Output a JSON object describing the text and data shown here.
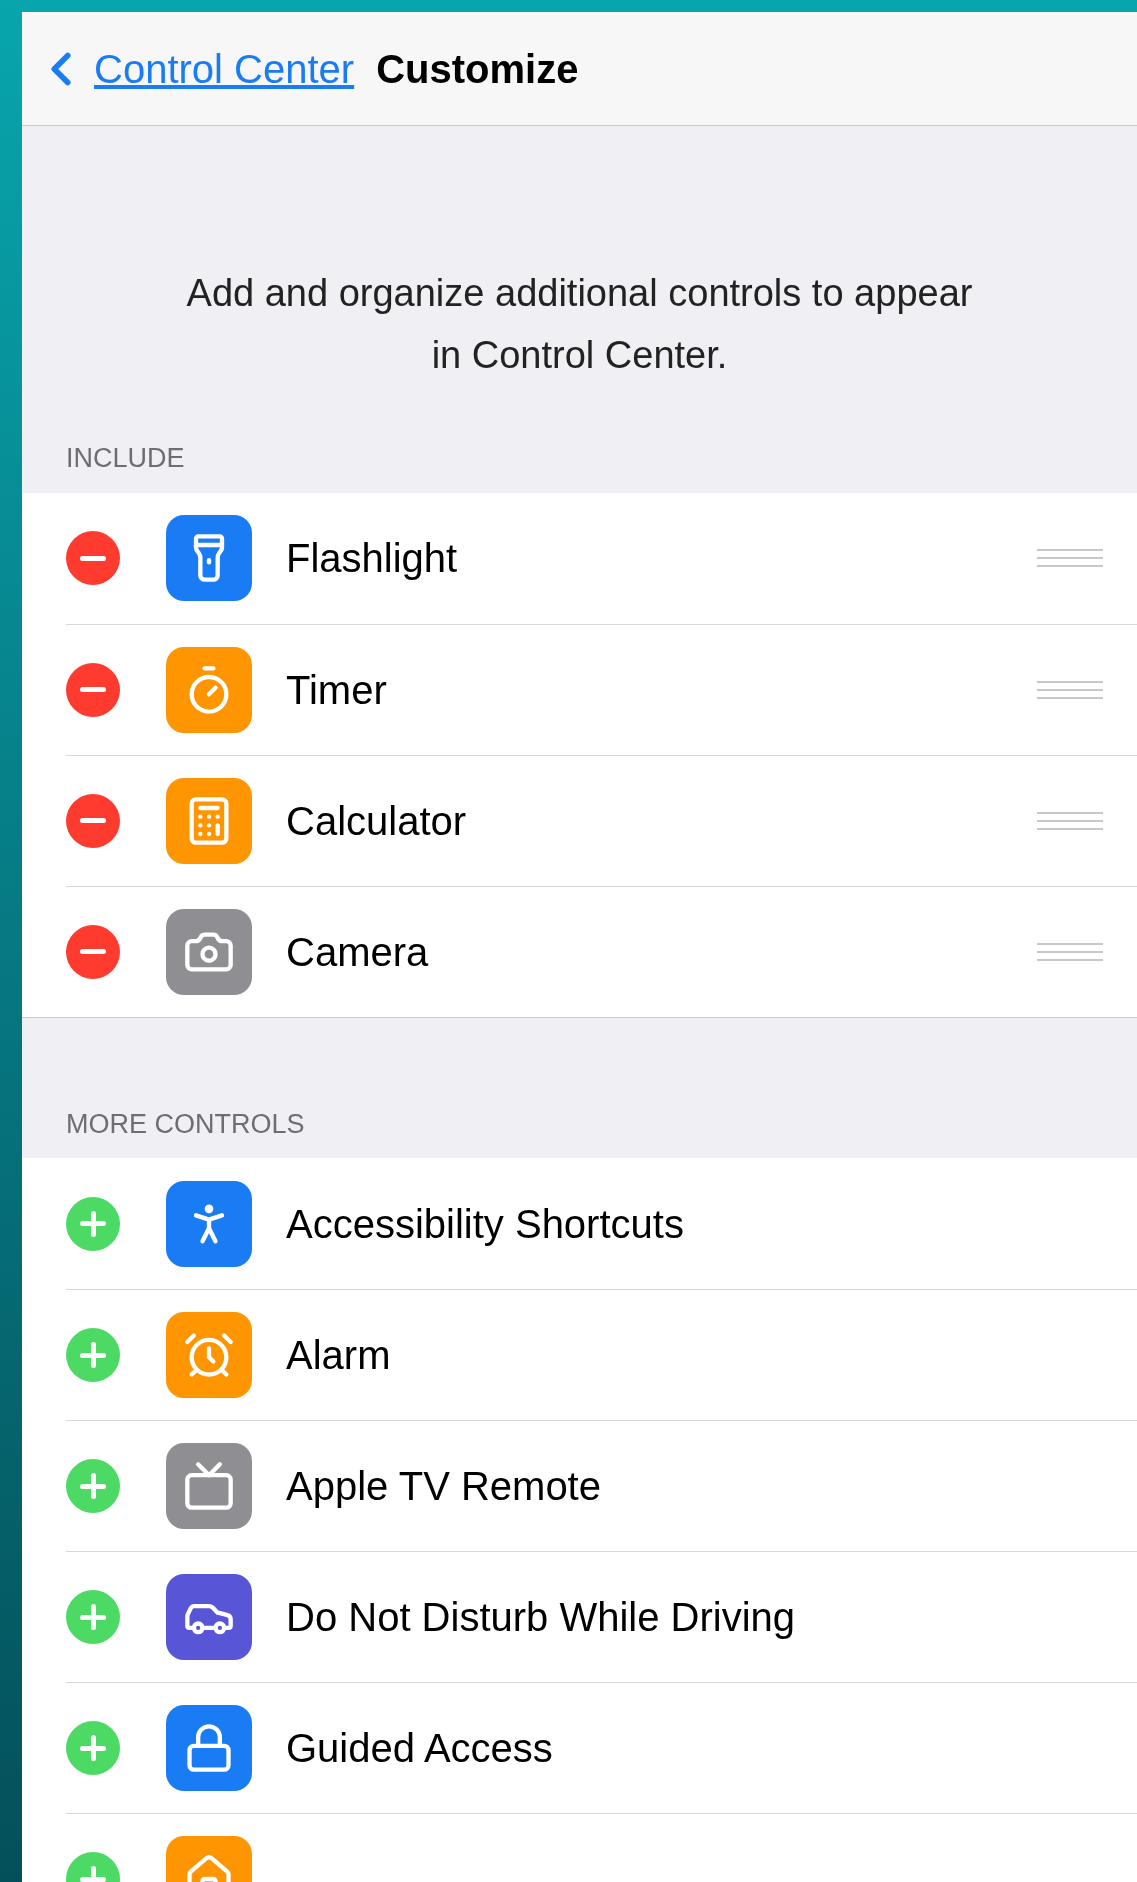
{
  "nav": {
    "back_label": "Control Center",
    "title": "Customize"
  },
  "description": "Add and organize additional controls to appear in Control Center.",
  "sections": [
    {
      "header": "INCLUDE",
      "kind": "remove",
      "items": [
        {
          "label": "Flashlight",
          "color": "#1a7cf5"
        },
        {
          "label": "Timer",
          "color": "#ff9500"
        },
        {
          "label": "Calculator",
          "color": "#ff9500"
        },
        {
          "label": "Camera",
          "color": "#8e8e93"
        }
      ]
    },
    {
      "header": "MORE CONTROLS",
      "kind": "add",
      "items": [
        {
          "label": "Accessibility Shortcuts",
          "color": "#1a7cf5"
        },
        {
          "label": "Alarm",
          "color": "#ff9500"
        },
        {
          "label": "Apple TV Remote",
          "color": "#8e8e93"
        },
        {
          "label": "Do Not Disturb While Driving",
          "color": "#5856d6"
        },
        {
          "label": "Guided Access",
          "color": "#1a7cf5"
        },
        {
          "color": "#ff9500"
        }
      ]
    }
  ]
}
